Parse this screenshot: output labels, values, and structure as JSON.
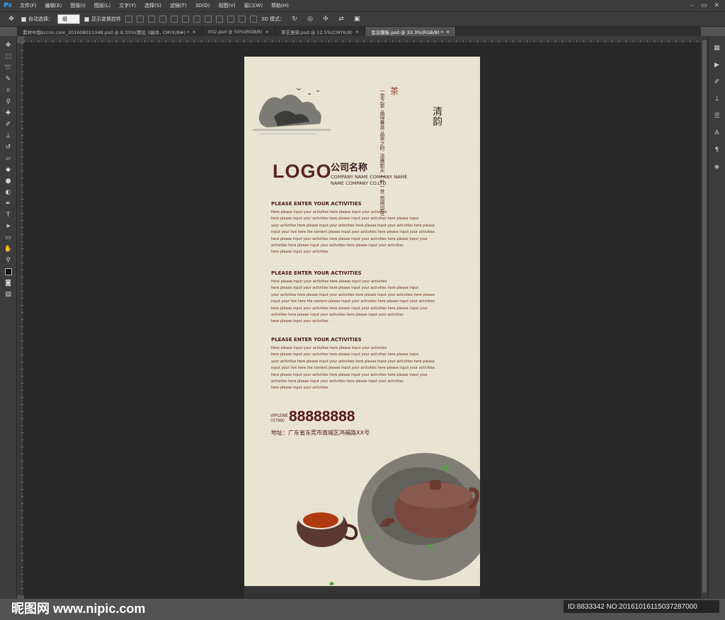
{
  "app": {
    "logo": "Ps"
  },
  "menu": [
    "文件(F)",
    "编辑(E)",
    "图像(I)",
    "图层(L)",
    "文字(Y)",
    "选择(S)",
    "滤镜(T)",
    "3D(D)",
    "视图(V)",
    "窗口(W)",
    "帮助(H)"
  ],
  "window_controls": [
    "–",
    "▭",
    "✕"
  ],
  "options": {
    "auto_select_label": "自动选择：",
    "auto_select_value": "组",
    "show_transform_label": "显示变换控件",
    "mode_3d_label": "3D 模式："
  },
  "tabs": [
    {
      "label": "素材中国sccnn.com_201608011048.psd @ 8.33%(图层 3副本, CMYK/8#) *",
      "close": "×"
    },
    {
      "label": "002.psd @ 50%(RGB/8)",
      "close": "×"
    },
    {
      "label": "茶艺展架.psd @ 12.5%(CMYK/8)",
      "close": "×"
    },
    {
      "label": "会议模板.psd @ 33.3%(RGB/8) *",
      "close": "×"
    }
  ],
  "colors": {
    "accent": "#31a8ff",
    "logo": "#5a2222",
    "text": "#4a1a10",
    "paper": "#e9e5d2"
  },
  "poster": {
    "seal": "茶",
    "poem_big": "清韵",
    "poem_lines": [
      "一壶之茶",
      "品得春意",
      "品茶之时",
      "淡雅新天",
      "一叶一世",
      "悠闲自在"
    ],
    "logo": "LOGO",
    "company_cn": "公司名称",
    "company_en_1": "COMPANY NAME COMPANY NAME",
    "company_en_2": "NAME COMPANY CO.LTD",
    "sections": [
      {
        "title": "PLEASE ENTER YOUR ACTIVITIES",
        "lines": [
          "Here please input your activities here please input your activities",
          "here please input your activities here please input your activities here please input",
          "your activities here please input your activities here please input your activities here please",
          "input your live here the content please input your activities here please input your activities",
          "here please input your activities here please input your activities here please input your",
          "activities here please input your activities here please input your activities",
          "here please input your activities"
        ]
      },
      {
        "title": "PLEASE ENTER YOUR ACTIVITIES",
        "lines": [
          "Here please input your activities here please input your activities",
          "here please input your activities here please input your activities here please input",
          "your activities here please input your activities here please input your activities here please",
          "input your live here the content please input your activities here please input your activities",
          "here please input your activities here please input your activities here please input your",
          "activities here please input your activities here please input your activities",
          "here please input your activities"
        ]
      },
      {
        "title": "PLEASE ENTER YOUR ACTIVITIES",
        "lines": [
          "Here please input your activities here please input your activities",
          "here please input your activities here please input your activities here please input",
          "your activities here please input your activities here please input your activities here please",
          "input your live here the content please input your activities here please input your activities",
          "here please input your activities here please input your activities here please input your",
          "activities here please input your activities here please input your activities",
          "here please input your activities"
        ]
      }
    ],
    "vip_label": "VIPLENE",
    "area_code": "(0769)",
    "phone": "88888888",
    "address": "地址：广东省东莞市南城区鸿福路XX号"
  },
  "watermark": {
    "left": "昵图网 www.nipic.com",
    "right": "ID:8833342 NO:20161016115037287000"
  }
}
